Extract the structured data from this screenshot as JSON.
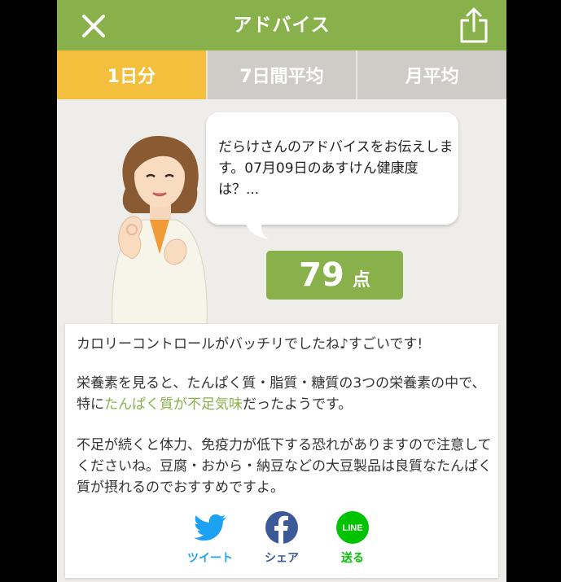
{
  "header": {
    "title": "アドバイス",
    "close_icon": "close-icon",
    "share_icon": "share-icon"
  },
  "tabs": [
    {
      "label": "1日分",
      "active": true
    },
    {
      "label": "7日間平均",
      "active": false
    },
    {
      "label": "月平均",
      "active": false
    }
  ],
  "advisor": {
    "bubble_text": "だらけさんのアドバイスをお伝えします。07月09日のあすけん健康度は？...",
    "score": "79",
    "score_unit": "点"
  },
  "advice": {
    "paragraph1": "カロリーコントロールがバッチリでしたね♪すごいです!",
    "paragraph2_before": "栄養素を見ると、たんぱく質・脂質・糖質の3つの栄養素の中で、特に",
    "paragraph2_highlight": "たんぱく質が不足気味",
    "paragraph2_after": "だったようです。",
    "paragraph3": "不足が続くと体力、免疫力が低下する恐れがありますので注意してくださいね。豆腐・おから・納豆などの大豆製品は良質なたんぱく質が摂れるのでおすすめですよ。"
  },
  "social": [
    {
      "label": "ツイート",
      "icon": "twitter-icon",
      "color": "#1da1f2"
    },
    {
      "label": "シェア",
      "icon": "facebook-icon",
      "color": "#3b5998"
    },
    {
      "label": "送る",
      "icon": "line-icon",
      "color": "#00c300",
      "icon_text": "LINE"
    }
  ],
  "colors": {
    "header": "#88b04b",
    "tab_active": "#f3bf3c",
    "tab_inactive": "#cfcbc7",
    "highlight": "#88b04b"
  }
}
